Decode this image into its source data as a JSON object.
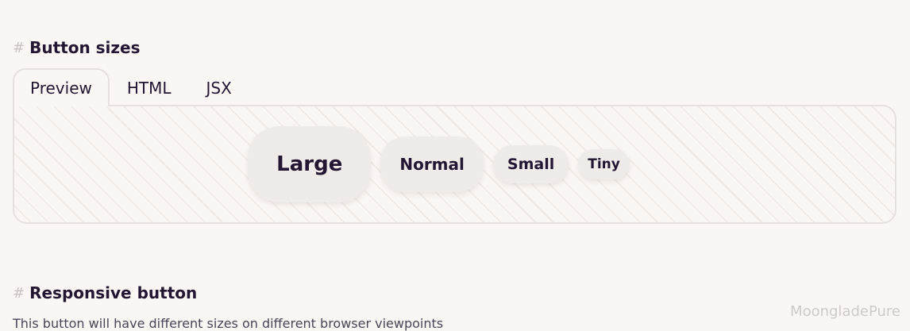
{
  "sections": [
    {
      "heading": "Button sizes"
    },
    {
      "heading": "Responsive button",
      "description": "This button will have different sizes on different browser viewpoints"
    }
  ],
  "hash_symbol": "#",
  "tabs": [
    {
      "label": "Preview",
      "active": true
    },
    {
      "label": "HTML",
      "active": false
    },
    {
      "label": "JSX",
      "active": false
    }
  ],
  "buttons": {
    "large": "Large",
    "normal": "Normal",
    "small": "Small",
    "tiny": "Tiny"
  },
  "watermark": "MoongladePure",
  "colors": {
    "background": "#faf6f3",
    "text": "#221633",
    "button_bg": "#efebe8",
    "border": "#e6e0de"
  }
}
